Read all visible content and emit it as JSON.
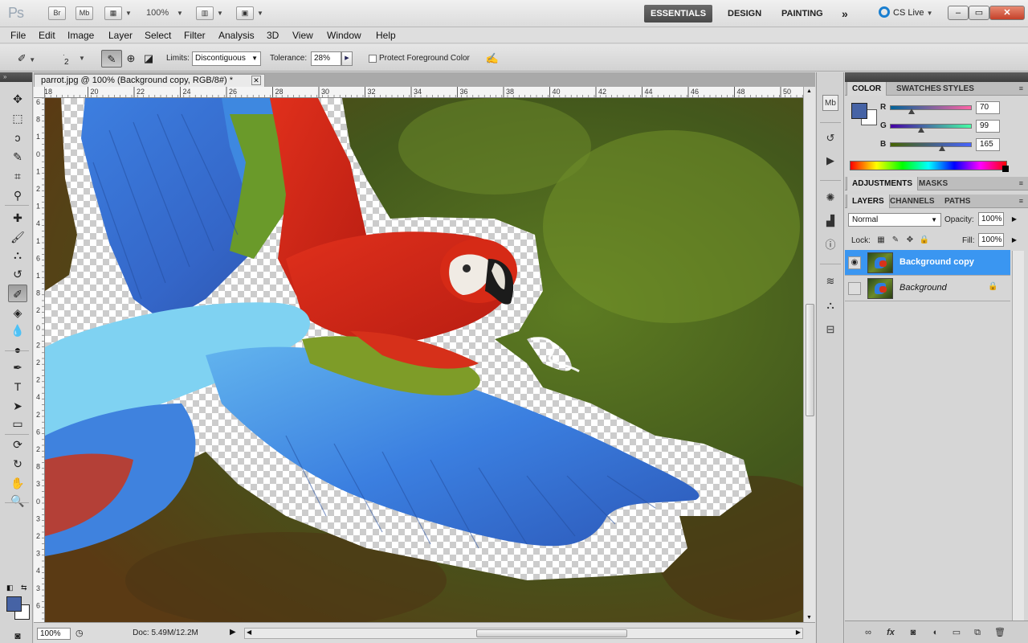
{
  "app": {
    "logo": "Ps",
    "bridge_label": "Br",
    "minibridge_label": "Mb",
    "zoom_value": "100%",
    "workspaces": [
      "ESSENTIALS",
      "DESIGN",
      "PAINTING"
    ],
    "more_workspaces": "»",
    "cs_live": "CS Live",
    "window_controls": {
      "minimize": "–",
      "maximize": "▭",
      "close": "✕"
    }
  },
  "menu": [
    "File",
    "Edit",
    "Image",
    "Layer",
    "Select",
    "Filter",
    "Analysis",
    "3D",
    "View",
    "Window",
    "Help"
  ],
  "options": {
    "brush_size": "2",
    "limits_label": "Limits:",
    "limits_value": "Discontiguous",
    "tolerance_label": "Tolerance:",
    "tolerance_value": "28%",
    "protect_label": "Protect Foreground Color",
    "protect_checked": false
  },
  "document": {
    "tab_title": "parrot.jpg @ 100% (Background copy, RGB/8#) *",
    "ruler_top": [
      "18",
      "20",
      "22",
      "24",
      "26",
      "28",
      "30",
      "32",
      "34",
      "36",
      "38",
      "40",
      "42",
      "44",
      "46",
      "48",
      "50"
    ],
    "ruler_left": [
      "6",
      "8",
      "1",
      "0",
      "1",
      "2",
      "1",
      "4",
      "1",
      "6",
      "1",
      "8",
      "2",
      "0",
      "2",
      "2",
      "2",
      "4",
      "2",
      "6",
      "2",
      "8",
      "3",
      "0",
      "3",
      "2",
      "3",
      "4",
      "3",
      "6"
    ],
    "status_zoom": "100%",
    "status_doc": "Doc: 5.49M/12.2M"
  },
  "tools": [
    {
      "name": "move-tool-icon",
      "glyph": "✥"
    },
    {
      "name": "marquee-tool-icon",
      "glyph": "⬚"
    },
    {
      "name": "lasso-tool-icon",
      "glyph": "ↄ"
    },
    {
      "name": "quick-selection-tool-icon",
      "glyph": "✎"
    },
    {
      "name": "crop-tool-icon",
      "glyph": "⌗"
    },
    {
      "name": "eyedropper-tool-icon",
      "glyph": "⚲"
    },
    {
      "name": "healing-brush-tool-icon",
      "glyph": "✚"
    },
    {
      "name": "brush-tool-icon",
      "glyph": "🖌"
    },
    {
      "name": "clone-stamp-tool-icon",
      "glyph": "⛬"
    },
    {
      "name": "history-brush-tool-icon",
      "glyph": "↺"
    },
    {
      "name": "background-eraser-tool-icon",
      "glyph": "✐"
    },
    {
      "name": "paint-bucket-tool-icon",
      "glyph": "◈"
    },
    {
      "name": "blur-tool-icon",
      "glyph": "💧"
    },
    {
      "name": "dodge-tool-icon",
      "glyph": "●"
    },
    {
      "name": "pen-tool-icon",
      "glyph": "✒"
    },
    {
      "name": "type-tool-icon",
      "glyph": "T"
    },
    {
      "name": "path-selection-tool-icon",
      "glyph": "➤"
    },
    {
      "name": "rectangle-tool-icon",
      "glyph": "▭"
    },
    {
      "name": "3d-rotate-tool-icon",
      "glyph": "⟳"
    },
    {
      "name": "3d-orbit-tool-icon",
      "glyph": "↻"
    },
    {
      "name": "hand-tool-icon",
      "glyph": "✋"
    },
    {
      "name": "zoom-tool-icon",
      "glyph": "🔍"
    }
  ],
  "colors": {
    "foreground": "#4663a5",
    "background": "#ffffff",
    "accent_selected": "#3a96f1"
  },
  "color_panel": {
    "tabs": [
      "COLOR",
      "SWATCHES",
      "STYLES"
    ],
    "sliders": [
      {
        "label": "R",
        "value": "70"
      },
      {
        "label": "G",
        "value": "99"
      },
      {
        "label": "B",
        "value": "165"
      }
    ]
  },
  "adjustments_panel": {
    "tabs": [
      "ADJUSTMENTS",
      "MASKS"
    ]
  },
  "layers_panel": {
    "tabs": [
      "LAYERS",
      "CHANNELS",
      "PATHS"
    ],
    "blend_mode": "Normal",
    "opacity_label": "Opacity:",
    "opacity_value": "100%",
    "lock_label": "Lock:",
    "fill_label": "Fill:",
    "fill_value": "100%",
    "layers": [
      {
        "name": "Background copy",
        "visible": true,
        "selected": true,
        "locked": false
      },
      {
        "name": "Background",
        "visible": false,
        "selected": false,
        "locked": true
      }
    ],
    "footer_icons": [
      "link-layers-icon",
      "fx-icon",
      "add-mask-icon",
      "adjustment-layer-icon",
      "new-group-icon",
      "new-layer-icon",
      "delete-layer-icon"
    ]
  }
}
